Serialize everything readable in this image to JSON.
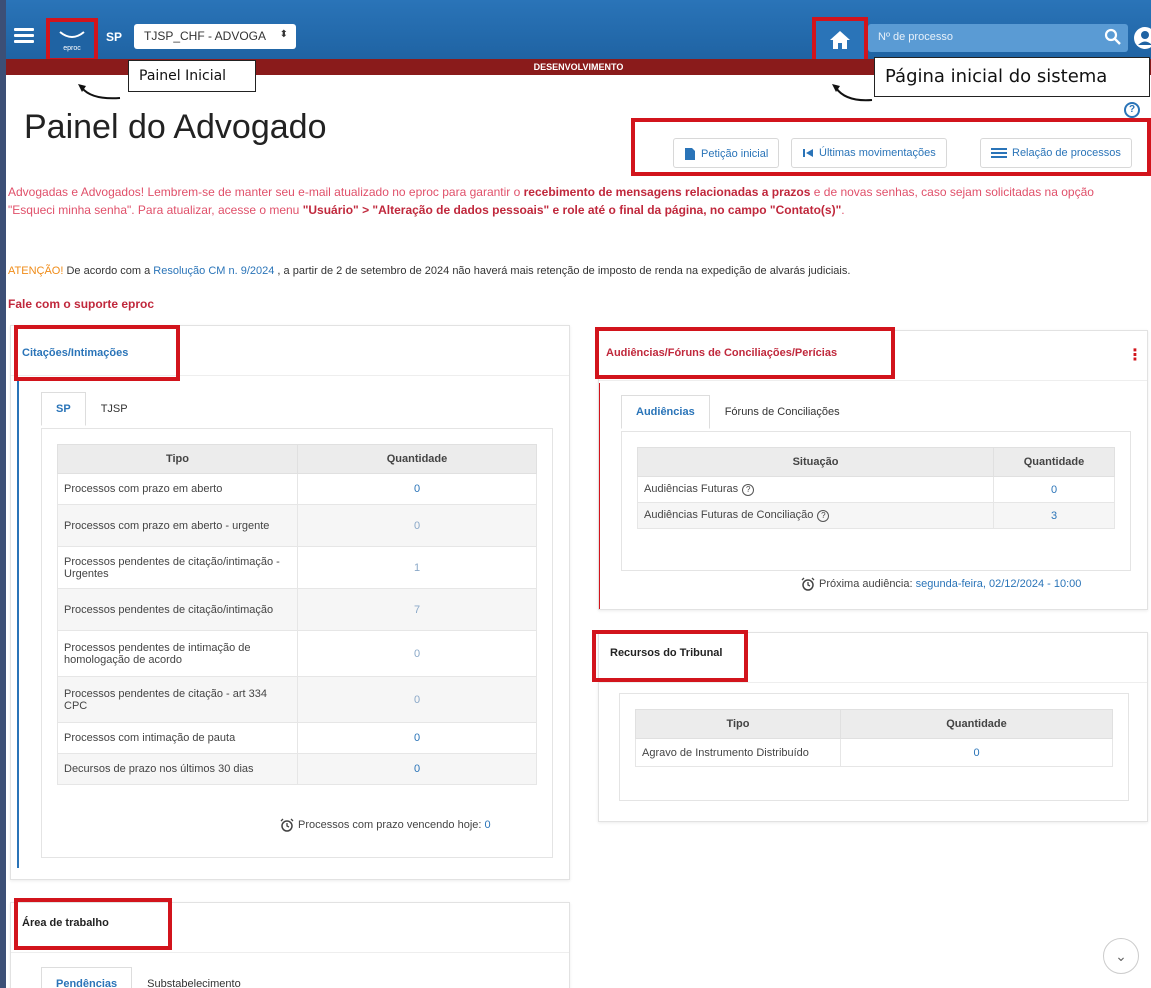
{
  "header": {
    "logo_text": "eproc",
    "state": "SP",
    "org_select_value": "TJSP_CHF - ADVOGA",
    "search_placeholder": "Nº de processo",
    "env_banner": "DESENVOLVIMENTO"
  },
  "callouts": {
    "painel_inicial": "Painel Inicial",
    "pagina_inicial": "Página inicial do sistema"
  },
  "page": {
    "title": "Painel do Advogado"
  },
  "actions": {
    "peticao": "Petição inicial",
    "movimentacoes": "Últimas movimentações",
    "relacao": "Relação de processos"
  },
  "notice": {
    "part1": "Advogadas e Advogados! Lembrem-se de manter seu e-mail atualizado no eproc para garantir o ",
    "bold1": "recebimento de mensagens relacionadas a prazos",
    "part2": " e de novas senhas, caso sejam solicitadas na opção \"Esqueci minha senha\". Para atualizar, acesse o menu ",
    "bold2": "\"Usuário\" > \"Alteração de dados pessoais\" e role até o final da página, no campo \"Contato(s)\"",
    "part3": "."
  },
  "atencao": {
    "label": "ATENÇÃO!",
    "before": " De acordo com a ",
    "link": "Resolução CM n. 9/2024",
    "after": " , a partir de 2 de setembro de 2024 não haverá mais retenção de imposto de renda na expedição de alvarás judiciais."
  },
  "suporte": "Fale com o suporte eproc",
  "citacoes": {
    "title": "Citações/Intimações",
    "tabs": [
      "SP",
      "TJSP"
    ],
    "headers": [
      "Tipo",
      "Quantidade"
    ],
    "rows": [
      {
        "tipo": "Processos com prazo em aberto",
        "qtd": "0"
      },
      {
        "tipo": "Processos com prazo em aberto - urgente",
        "qtd": "0"
      },
      {
        "tipo": "Processos pendentes de citação/intimação - Urgentes",
        "qtd": "1"
      },
      {
        "tipo": "Processos pendentes de citação/intimação",
        "qtd": "7"
      },
      {
        "tipo": "Processos pendentes de intimação de homologação de acordo",
        "qtd": "0"
      },
      {
        "tipo": "Processos pendentes de citação - art 334 CPC",
        "qtd": "0"
      },
      {
        "tipo": "Processos com intimação de pauta",
        "qtd": "0"
      },
      {
        "tipo": "Decursos de prazo nos últimos 30 dias",
        "qtd": "0"
      }
    ],
    "footer_label": "Processos com prazo vencendo hoje:",
    "footer_value": "0"
  },
  "audiencias": {
    "title": "Audiências/Fóruns de Conciliações/Perícias",
    "tabs": [
      "Audiências",
      "Fóruns de Conciliações"
    ],
    "headers": [
      "Situação",
      "Quantidade"
    ],
    "rows": [
      {
        "situacao": "Audiências Futuras",
        "qtd": "0"
      },
      {
        "situacao": "Audiências Futuras de Conciliação",
        "qtd": "3"
      }
    ],
    "footer_label": "Próxima audiência:",
    "footer_value": "segunda-feira, 02/12/2024 - 10:00"
  },
  "recursos": {
    "title": "Recursos do Tribunal",
    "headers": [
      "Tipo",
      "Quantidade"
    ],
    "rows": [
      {
        "tipo": "Agravo de Instrumento Distribuído",
        "qtd": "0"
      }
    ]
  },
  "area": {
    "title": "Área de trabalho",
    "tabs": [
      "Pendências",
      "Substabelecimento"
    ]
  },
  "colors": {
    "brand_blue": "#2a74b8",
    "highlight_red": "#d2141c",
    "notice_pink": "#e0506a",
    "dev_banner": "#8a1b1b"
  }
}
